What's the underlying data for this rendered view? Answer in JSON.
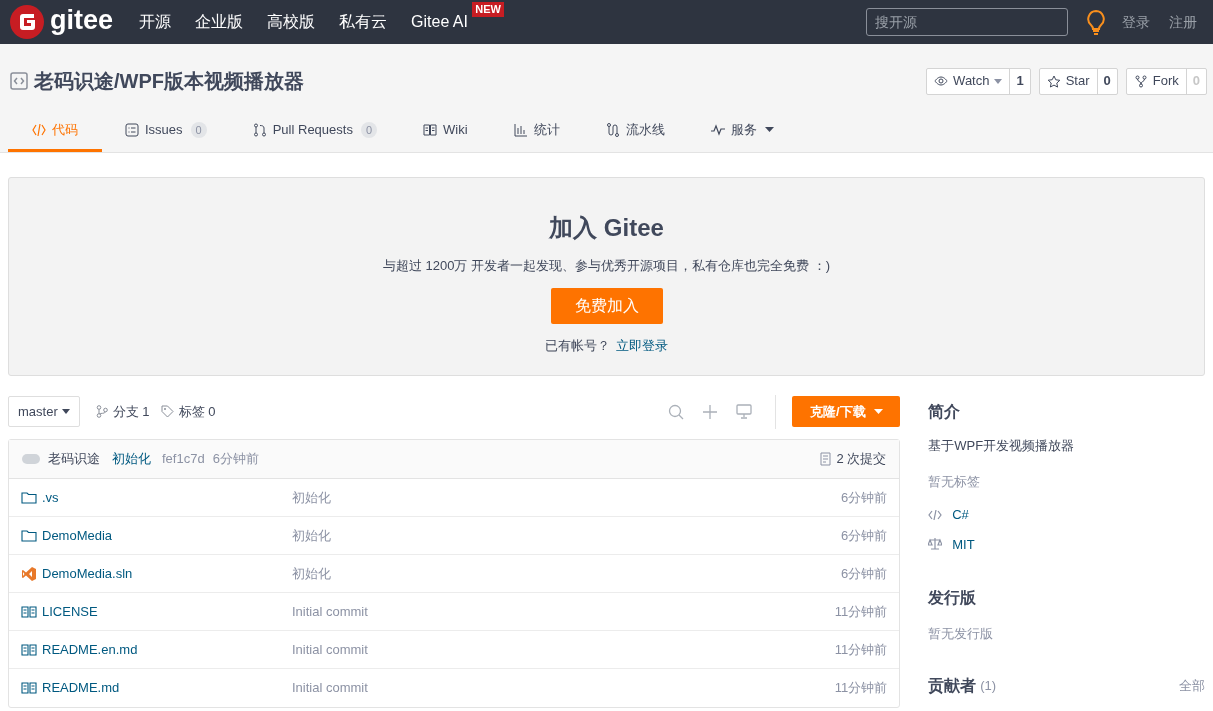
{
  "header": {
    "logo": "gitee",
    "nav": [
      {
        "label": "开源"
      },
      {
        "label": "企业版"
      },
      {
        "label": "高校版"
      },
      {
        "label": "私有云"
      },
      {
        "label": "Gitee AI",
        "badge": "NEW"
      }
    ],
    "search": {
      "placeholder": "搜开源"
    },
    "login": "登录",
    "register": "注册"
  },
  "repo": {
    "title": "老码识途/WPF版本视频播放器",
    "actions": [
      {
        "label": "Watch",
        "count": "1",
        "kind": "watch",
        "dropdown": true,
        "count_muted": false
      },
      {
        "label": "Star",
        "count": "0",
        "kind": "star",
        "dropdown": false,
        "count_muted": false
      },
      {
        "label": "Fork",
        "count": "0",
        "kind": "fork",
        "dropdown": false,
        "count_muted": true
      }
    ]
  },
  "tabs": [
    {
      "label": "代码",
      "kind": "code",
      "selected": true
    },
    {
      "label": "Issues",
      "kind": "issues",
      "count": "0",
      "selected": false
    },
    {
      "label": "Pull Requests",
      "kind": "pr",
      "count": "0",
      "selected": false
    },
    {
      "label": "Wiki",
      "kind": "wiki",
      "selected": false
    },
    {
      "label": "统计",
      "kind": "stats",
      "selected": false
    },
    {
      "label": "流水线",
      "kind": "pipeline",
      "selected": false
    },
    {
      "label": "服务",
      "kind": "service",
      "dropdown": true,
      "selected": false
    }
  ],
  "banner": {
    "title": "加入 Gitee",
    "subtitle": "与超过 1200万 开发者一起发现、参与优秀开源项目，私有仓库也完全免费 ：)",
    "button": "免费加入",
    "prompt": "已有帐号？",
    "link": "立即登录"
  },
  "toolbar": {
    "branch": "master",
    "branches": "分支 1",
    "tags": "标签 0",
    "clone": "克隆/下载"
  },
  "commit": {
    "author": "老码识途",
    "message": "初始化",
    "hash": "fef1c7d",
    "time": "6分钟前",
    "count": "2 次提交"
  },
  "files": [
    {
      "name": ".vs",
      "kind": "folder",
      "message": "初始化",
      "time": "6分钟前"
    },
    {
      "name": "DemoMedia",
      "kind": "folder",
      "message": "初始化",
      "time": "6分钟前"
    },
    {
      "name": "DemoMedia.sln",
      "kind": "solution",
      "message": "初始化",
      "time": "6分钟前"
    },
    {
      "name": "LICENSE",
      "kind": "doc",
      "message": "Initial commit",
      "time": "11分钟前"
    },
    {
      "name": "README.en.md",
      "kind": "doc",
      "message": "Initial commit",
      "time": "11分钟前"
    },
    {
      "name": "README.md",
      "kind": "doc",
      "message": "Initial commit",
      "time": "11分钟前"
    }
  ],
  "sidebar": {
    "intro_heading": "简介",
    "description": "基于WPF开发视频播放器",
    "tags_empty": "暂无标签",
    "language": "C#",
    "license": "MIT",
    "releases_heading": "发行版",
    "releases_empty": "暂无发行版",
    "contributors_heading": "贡献者",
    "contributors_count": "(1)",
    "contributors_all": "全部"
  }
}
